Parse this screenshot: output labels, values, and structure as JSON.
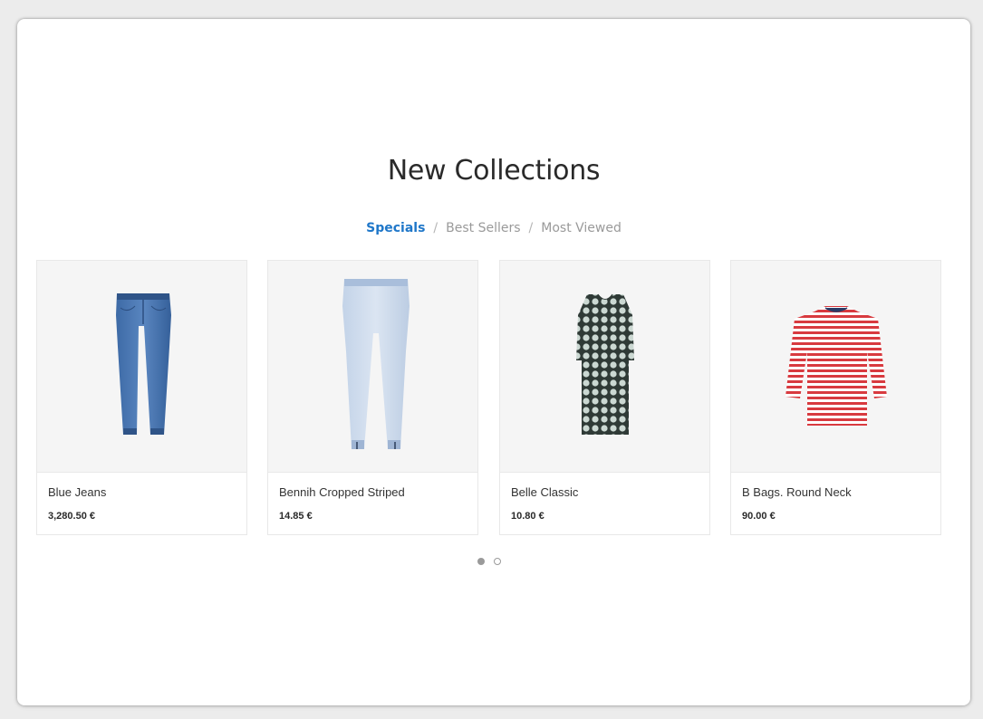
{
  "section": {
    "title": "New Collections"
  },
  "tabs": [
    {
      "label": "Specials",
      "active": true
    },
    {
      "label": "Best Sellers",
      "active": false
    },
    {
      "label": "Most Viewed",
      "active": false
    }
  ],
  "tab_separator": "/",
  "products": [
    {
      "name": "Blue Jeans",
      "price": "3,280.50 €",
      "image_icon": "jeans-icon"
    },
    {
      "name": "Bennih Cropped Striped",
      "price": "14.85 €",
      "image_icon": "light-jeans-icon"
    },
    {
      "name": "Belle Classic",
      "price": "10.80 €",
      "image_icon": "dress-icon"
    },
    {
      "name": "B Bags. Round Neck",
      "price": "90.00 €",
      "image_icon": "striped-top-icon"
    }
  ],
  "carousel": {
    "pages": 2,
    "current": 1
  },
  "colors": {
    "accent": "#1f77c9",
    "muted": "#9a9a9a",
    "image_bg": "#f5f5f5"
  }
}
